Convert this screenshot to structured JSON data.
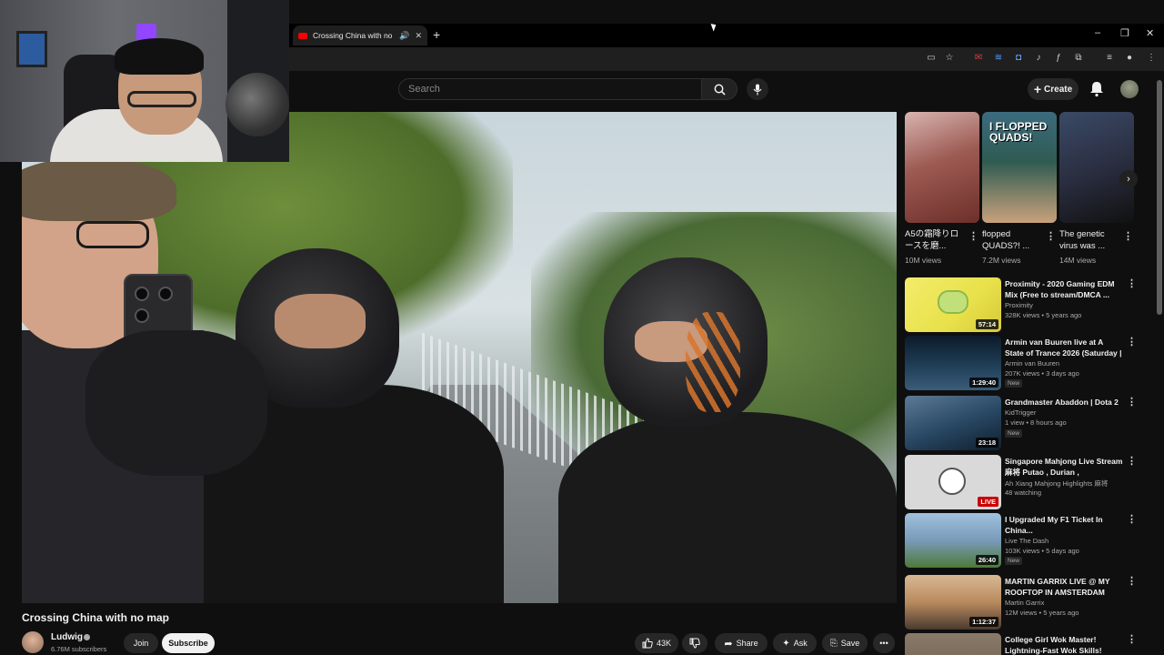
{
  "browser": {
    "tab_title": "Crossing China with no map",
    "new_tab_label": "+",
    "window_controls": [
      "–",
      "❐",
      "✕"
    ]
  },
  "masthead": {
    "search_placeholder": "Search",
    "create_label": "Create"
  },
  "video": {
    "title": "Crossing China with no map",
    "channel": "Ludwig",
    "subscribers": "6.76M subscribers",
    "join_label": "Join",
    "subscribe_label": "Subscribe",
    "likes": "43K",
    "share_label": "Share",
    "ask_label": "Ask",
    "save_label": "Save"
  },
  "shorts": [
    {
      "title": "A5の霜降りロースを磨...",
      "views": "10M views",
      "thumb_color": "#9c5a52"
    },
    {
      "title": "flopped QUADS?! ...",
      "views": "7.2M views",
      "thumb_color": "#2f5b52"
    },
    {
      "title": "The genetic virus was ...",
      "views": "14M views",
      "thumb_color": "#2b2f42"
    }
  ],
  "recommendations": [
    {
      "title": "Proximity - 2020 Gaming EDM Mix (Free to stream/DMCA ...",
      "channel": "Proximity",
      "meta": "328K views • 5 years ago",
      "duration": "57:14",
      "badge": "",
      "thumb_color": "#e8e14a"
    },
    {
      "title": "Armin van Buuren live at A State of Trance 2026 (Saturday | Are...",
      "channel": "Armin van Buuren",
      "meta": "207K views • 3 days ago",
      "duration": "1:29:40",
      "badge": "New",
      "thumb_color": "#1d3b52"
    },
    {
      "title": "Grandmaster Abaddon | Dota 2",
      "channel": "KidTrigger",
      "meta": "1 view • 8 hours ago",
      "duration": "23:18",
      "badge": "New",
      "thumb_color": "#2a4a66"
    },
    {
      "title": "Singapore Mahjong Live Stream 麻将 Putao , Durian , Strawberr...",
      "channel": "Ah Xiang Mahjong Highlights 麻将",
      "meta": "48 watching",
      "duration": "LIVE",
      "badge": "",
      "thumb_color": "#d6d6d6"
    },
    {
      "title": "I Upgraded My F1 Ticket In China...",
      "channel": "Live The Dash",
      "meta": "103K views • 5 days ago",
      "duration": "26:40",
      "badge": "New",
      "thumb_color": "#7a9ab8"
    },
    {
      "title": "MARTIN GARRIX LIVE @ MY ROOFTOP IN AMSTERDAM",
      "channel": "Martin Garrix",
      "meta": "12M views • 5 years ago",
      "duration": "1:12:37",
      "badge": "",
      "thumb_color": "#b98a5e"
    },
    {
      "title": "College Girl Wok Master! Lightning-Fast Wok Skills! Frie...",
      "channel": "",
      "meta": "",
      "duration": "",
      "badge": "",
      "thumb_color": "#6a5a4a"
    }
  ]
}
